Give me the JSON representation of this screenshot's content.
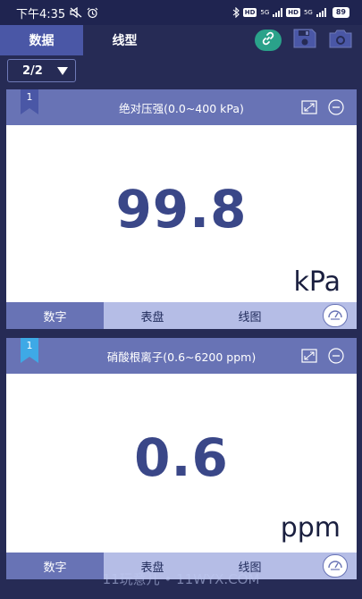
{
  "status": {
    "time": "下午4:35",
    "network1": "5G",
    "network2": "5G",
    "hd1": "HD",
    "hd2": "HD",
    "battery": "89"
  },
  "tabs": [
    {
      "label": "数据",
      "active": true
    },
    {
      "label": "线型",
      "active": false
    }
  ],
  "toolbar": {
    "link_icon": "link-icon",
    "save_icon": "save-icon",
    "camera_icon": "camera-icon"
  },
  "page_selector": {
    "value": "2/2"
  },
  "panels": [
    {
      "index": "1",
      "title": "绝对压强(0.0~400 kPa)",
      "value": "99.8",
      "unit": "kPa",
      "view_tabs": [
        "数字",
        "表盘",
        "线图"
      ],
      "active_view": "数字",
      "ribbon_color": "#4a57a6"
    },
    {
      "index": "1",
      "title": "硝酸根离子(0.6~6200 ppm)",
      "value": "0.6",
      "unit": "ppm",
      "view_tabs": [
        "数字",
        "表盘",
        "线图"
      ],
      "active_view": "数字",
      "ribbon_color": "#3ea9e6"
    }
  ],
  "watermark": "11玩意儿 • 11WYX.COM",
  "colors": {
    "background": "#262b55",
    "accent": "#6873b5",
    "value_text": "#3a4788",
    "link_button": "#2aa28a"
  }
}
